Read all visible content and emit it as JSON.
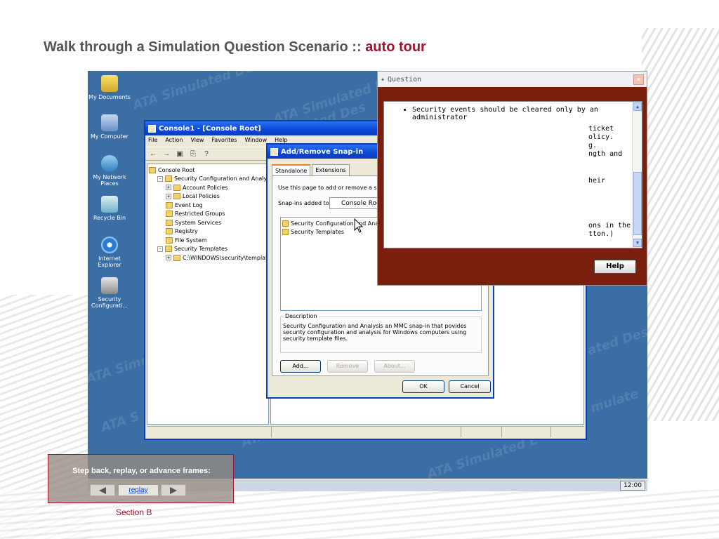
{
  "slide": {
    "title_main": "Walk through a Simulation Question Scenario :: ",
    "title_accent": "auto tour",
    "section": "Section B"
  },
  "desktop": {
    "watermarks": [
      "ATA Simulated Des",
      "ATA Simulated Des",
      "ATA Simu",
      "ATA S",
      "ATA Si",
      "ated Des",
      "mulate",
      "ATA Simulated E",
      "ATA Simulated Des"
    ],
    "icons": [
      {
        "label": "My Documents",
        "icon": "my-documents-icon"
      },
      {
        "label": "My Computer",
        "icon": "my-computer-icon"
      },
      {
        "label": "My Network Places",
        "icon": "network-places-icon"
      },
      {
        "label": "Recycle Bin",
        "icon": "recycle-bin-icon"
      },
      {
        "label": "Internet Explorer",
        "icon": "internet-explorer-icon"
      },
      {
        "label": "Security Configurati...",
        "icon": "security-config-icon"
      }
    ],
    "clock": "12:00"
  },
  "console": {
    "title": "Console1 - [Console Root]",
    "menu": [
      "File",
      "Action",
      "View",
      "Favorites",
      "Window",
      "Help"
    ],
    "tree": [
      {
        "label": "Console Root",
        "indent": 0,
        "expander": ""
      },
      {
        "label": "Security Configuration and Analysis",
        "indent": 1,
        "expander": "-"
      },
      {
        "label": "Account Policies",
        "indent": 2,
        "expander": "+"
      },
      {
        "label": "Local Policies",
        "indent": 2,
        "expander": "+"
      },
      {
        "label": "Event Log",
        "indent": 2,
        "expander": ""
      },
      {
        "label": "Restricted Groups",
        "indent": 2,
        "expander": ""
      },
      {
        "label": "System Services",
        "indent": 2,
        "expander": ""
      },
      {
        "label": "Registry",
        "indent": 2,
        "expander": ""
      },
      {
        "label": "File System",
        "indent": 2,
        "expander": ""
      },
      {
        "label": "Security Templates",
        "indent": 1,
        "expander": "-"
      },
      {
        "label": "C:\\WINDOWS\\security\\templates",
        "indent": 2,
        "expander": "+"
      }
    ]
  },
  "snapin": {
    "title": "Add/Remove Snap-in",
    "tabs": [
      "Standalone",
      "Extensions"
    ],
    "intro": "Use this page to add or remove a standalone Snap-in from the console.",
    "added_to_label": "Snap-ins added to:",
    "added_to_value": "Console Root",
    "items": [
      "Security Configuration and Analysis",
      "Security Templates"
    ],
    "description_legend": "Description",
    "description": "Security Configuration and Analysis an MMC snap-in that povides security configuration and analysis for Windows computers using security template files.",
    "buttons": {
      "add": "Add...",
      "remove": "Remove",
      "about": "About...",
      "ok": "OK",
      "cancel": "Cancel"
    }
  },
  "question": {
    "title": "Question",
    "bullet": "Security events should be cleared only by an administrator",
    "fragments": [
      "ticket",
      "olicy.",
      "g.",
      "ngth and",
      "heir",
      "ons in the",
      "tton.)"
    ],
    "help": "Help"
  },
  "nav": {
    "label": "Step back, replay, or advance frames:",
    "replay": "replay"
  }
}
